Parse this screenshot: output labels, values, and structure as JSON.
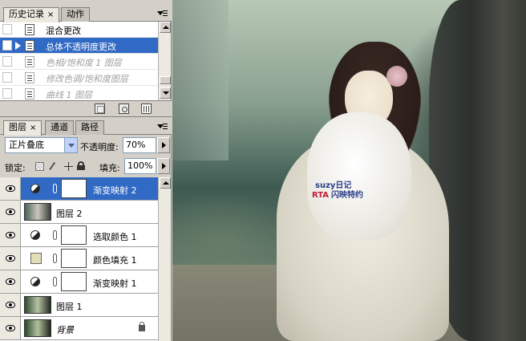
{
  "history_panel": {
    "tabs": [
      {
        "label": "历史记录",
        "active": true,
        "close": "×"
      },
      {
        "label": "动作",
        "active": false
      }
    ],
    "items": [
      {
        "label": "混合更改",
        "state": "normal"
      },
      {
        "label": "总体不透明度更改",
        "state": "selected"
      },
      {
        "label": "色相/饱和度 1 图层",
        "state": "dimmed"
      },
      {
        "label": "修改色调/饱和度图层",
        "state": "dimmed"
      },
      {
        "label": "曲线 1 图层",
        "state": "dimmed"
      }
    ],
    "footer_icons": [
      "new-document-icon",
      "snapshot-camera-icon",
      "trash-icon"
    ]
  },
  "layers_panel": {
    "tabs": [
      {
        "label": "图层",
        "active": true,
        "close": "×"
      },
      {
        "label": "通道",
        "active": false
      },
      {
        "label": "路径",
        "active": false
      }
    ],
    "blend_mode": "正片叠底",
    "opacity_label": "不透明度:",
    "opacity_value": "70%",
    "lock_label": "锁定:",
    "fill_label": "填充:",
    "fill_value": "100%",
    "layers": [
      {
        "name": "渐变映射 2",
        "kind": "adjustment",
        "selected": true
      },
      {
        "name": "图层 2",
        "kind": "image",
        "selected": false
      },
      {
        "name": "选取颜色 1",
        "kind": "adjustment",
        "selected": false
      },
      {
        "name": "颜色填充 1",
        "kind": "fill",
        "selected": false,
        "swatch": "#e3ddb8"
      },
      {
        "name": "渐变映射 1",
        "kind": "adjustment",
        "selected": false
      },
      {
        "name": "图层 1",
        "kind": "image",
        "selected": false
      },
      {
        "name": "背景",
        "kind": "background",
        "selected": false,
        "locked": true
      }
    ]
  },
  "canvas": {
    "watermark_line1": "suzy日记",
    "watermark_line2_red": "RTA",
    "watermark_line2_blue": "闪映特约"
  },
  "colors": {
    "selection": "#316ac5",
    "panel_bg": "#d4d0c8"
  }
}
